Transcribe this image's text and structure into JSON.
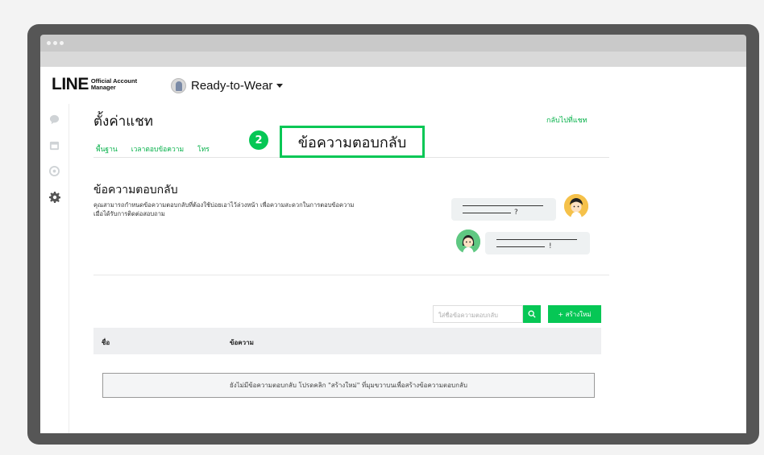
{
  "brand": {
    "logo": "LINE",
    "product_line1": "Official Account",
    "product_line2": "Manager"
  },
  "account": {
    "name": "Ready-to-Wear"
  },
  "sidebar": {
    "icons": [
      "chat-icon",
      "calendar-icon",
      "coin-icon",
      "gear-icon"
    ]
  },
  "page": {
    "title": "ตั้งค่าแชท",
    "back_link": "กลับไปที่แชท",
    "tabs": [
      {
        "label": "พื้นฐาน"
      },
      {
        "label": "เวลาตอบข้อความ"
      },
      {
        "label": "โทร"
      }
    ],
    "callout": {
      "number": "2",
      "label": "ข้อความตอบกลับ"
    }
  },
  "section": {
    "title": "ข้อความตอบกลับ",
    "desc_line1": "คุณสามารถกำหนดข้อความตอบกลับที่ต้องใช้บ่อยเอาไว้ล่วงหน้า เพื่อความสะดวกในการตอบข้อความ",
    "desc_line2": "เมื่อได้รับการติดต่อสอบถาม"
  },
  "illustration": {
    "question_mark": "?",
    "exclaim_mark": "!"
  },
  "toolbar": {
    "search_placeholder": "ใส่ชื่อข้อความตอบกลับ",
    "create_label": "+ สร้างใหม่"
  },
  "table": {
    "columns": [
      "ชื่อ",
      "ข้อความ"
    ],
    "empty_message": "ยังไม่มีข้อความตอบกลับ โปรดคลิก \"สร้างใหม่\" ที่มุมขวาบนเพื่อสร้างข้อความตอบกลับ"
  },
  "colors": {
    "accent": "#06c755",
    "frame": "#565656"
  }
}
